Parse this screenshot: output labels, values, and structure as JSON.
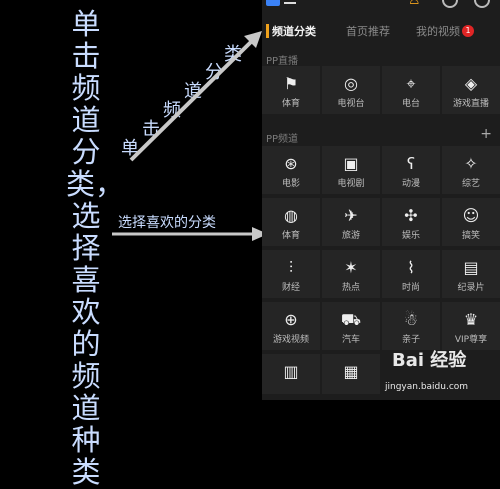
{
  "annotation": {
    "vertical_text": "单击频道分类，选择喜欢的频道种类",
    "stair_chars": [
      "单",
      "击",
      "频",
      "道",
      "分",
      "类"
    ],
    "arrow_label": "选择喜欢的分类"
  },
  "app": {
    "tabs": [
      {
        "label": "频道分类",
        "active": true
      },
      {
        "label": "首页推荐",
        "active": false
      },
      {
        "label": "我的视频",
        "active": false
      }
    ],
    "badge_count": "1",
    "sections": [
      {
        "title": "PP直播",
        "items": [
          {
            "label": "体育",
            "icon": "flag-icon"
          },
          {
            "label": "电视台",
            "icon": "tv-station-icon"
          },
          {
            "label": "电台",
            "icon": "radio-tower-icon"
          },
          {
            "label": "游戏直播",
            "icon": "game-live-icon"
          }
        ]
      },
      {
        "title": "PP频道",
        "items": [
          {
            "label": "电影",
            "icon": "film-reel-icon"
          },
          {
            "label": "电视剧",
            "icon": "tv-icon"
          },
          {
            "label": "动漫",
            "icon": "bear-icon"
          },
          {
            "label": "综艺",
            "icon": "stars-icon"
          },
          {
            "label": "体育",
            "icon": "ball-icon"
          },
          {
            "label": "旅游",
            "icon": "airplane-icon"
          },
          {
            "label": "娱乐",
            "icon": "puzzle-icon"
          },
          {
            "label": "搞笑",
            "icon": "smile-icon"
          },
          {
            "label": "财经",
            "icon": "chart-icon"
          },
          {
            "label": "热点",
            "icon": "star-burst-icon"
          },
          {
            "label": "时尚",
            "icon": "high-heel-icon"
          },
          {
            "label": "纪录片",
            "icon": "camera-icon"
          },
          {
            "label": "游戏视频",
            "icon": "gamepad-icon"
          },
          {
            "label": "汽车",
            "icon": "car-icon"
          },
          {
            "label": "亲子",
            "icon": "baby-icon"
          },
          {
            "label": "VIP尊享",
            "icon": "crown-icon"
          }
        ]
      }
    ]
  },
  "watermark": {
    "brand": "Bai 经验",
    "url": "jingyan.baidu.com"
  }
}
